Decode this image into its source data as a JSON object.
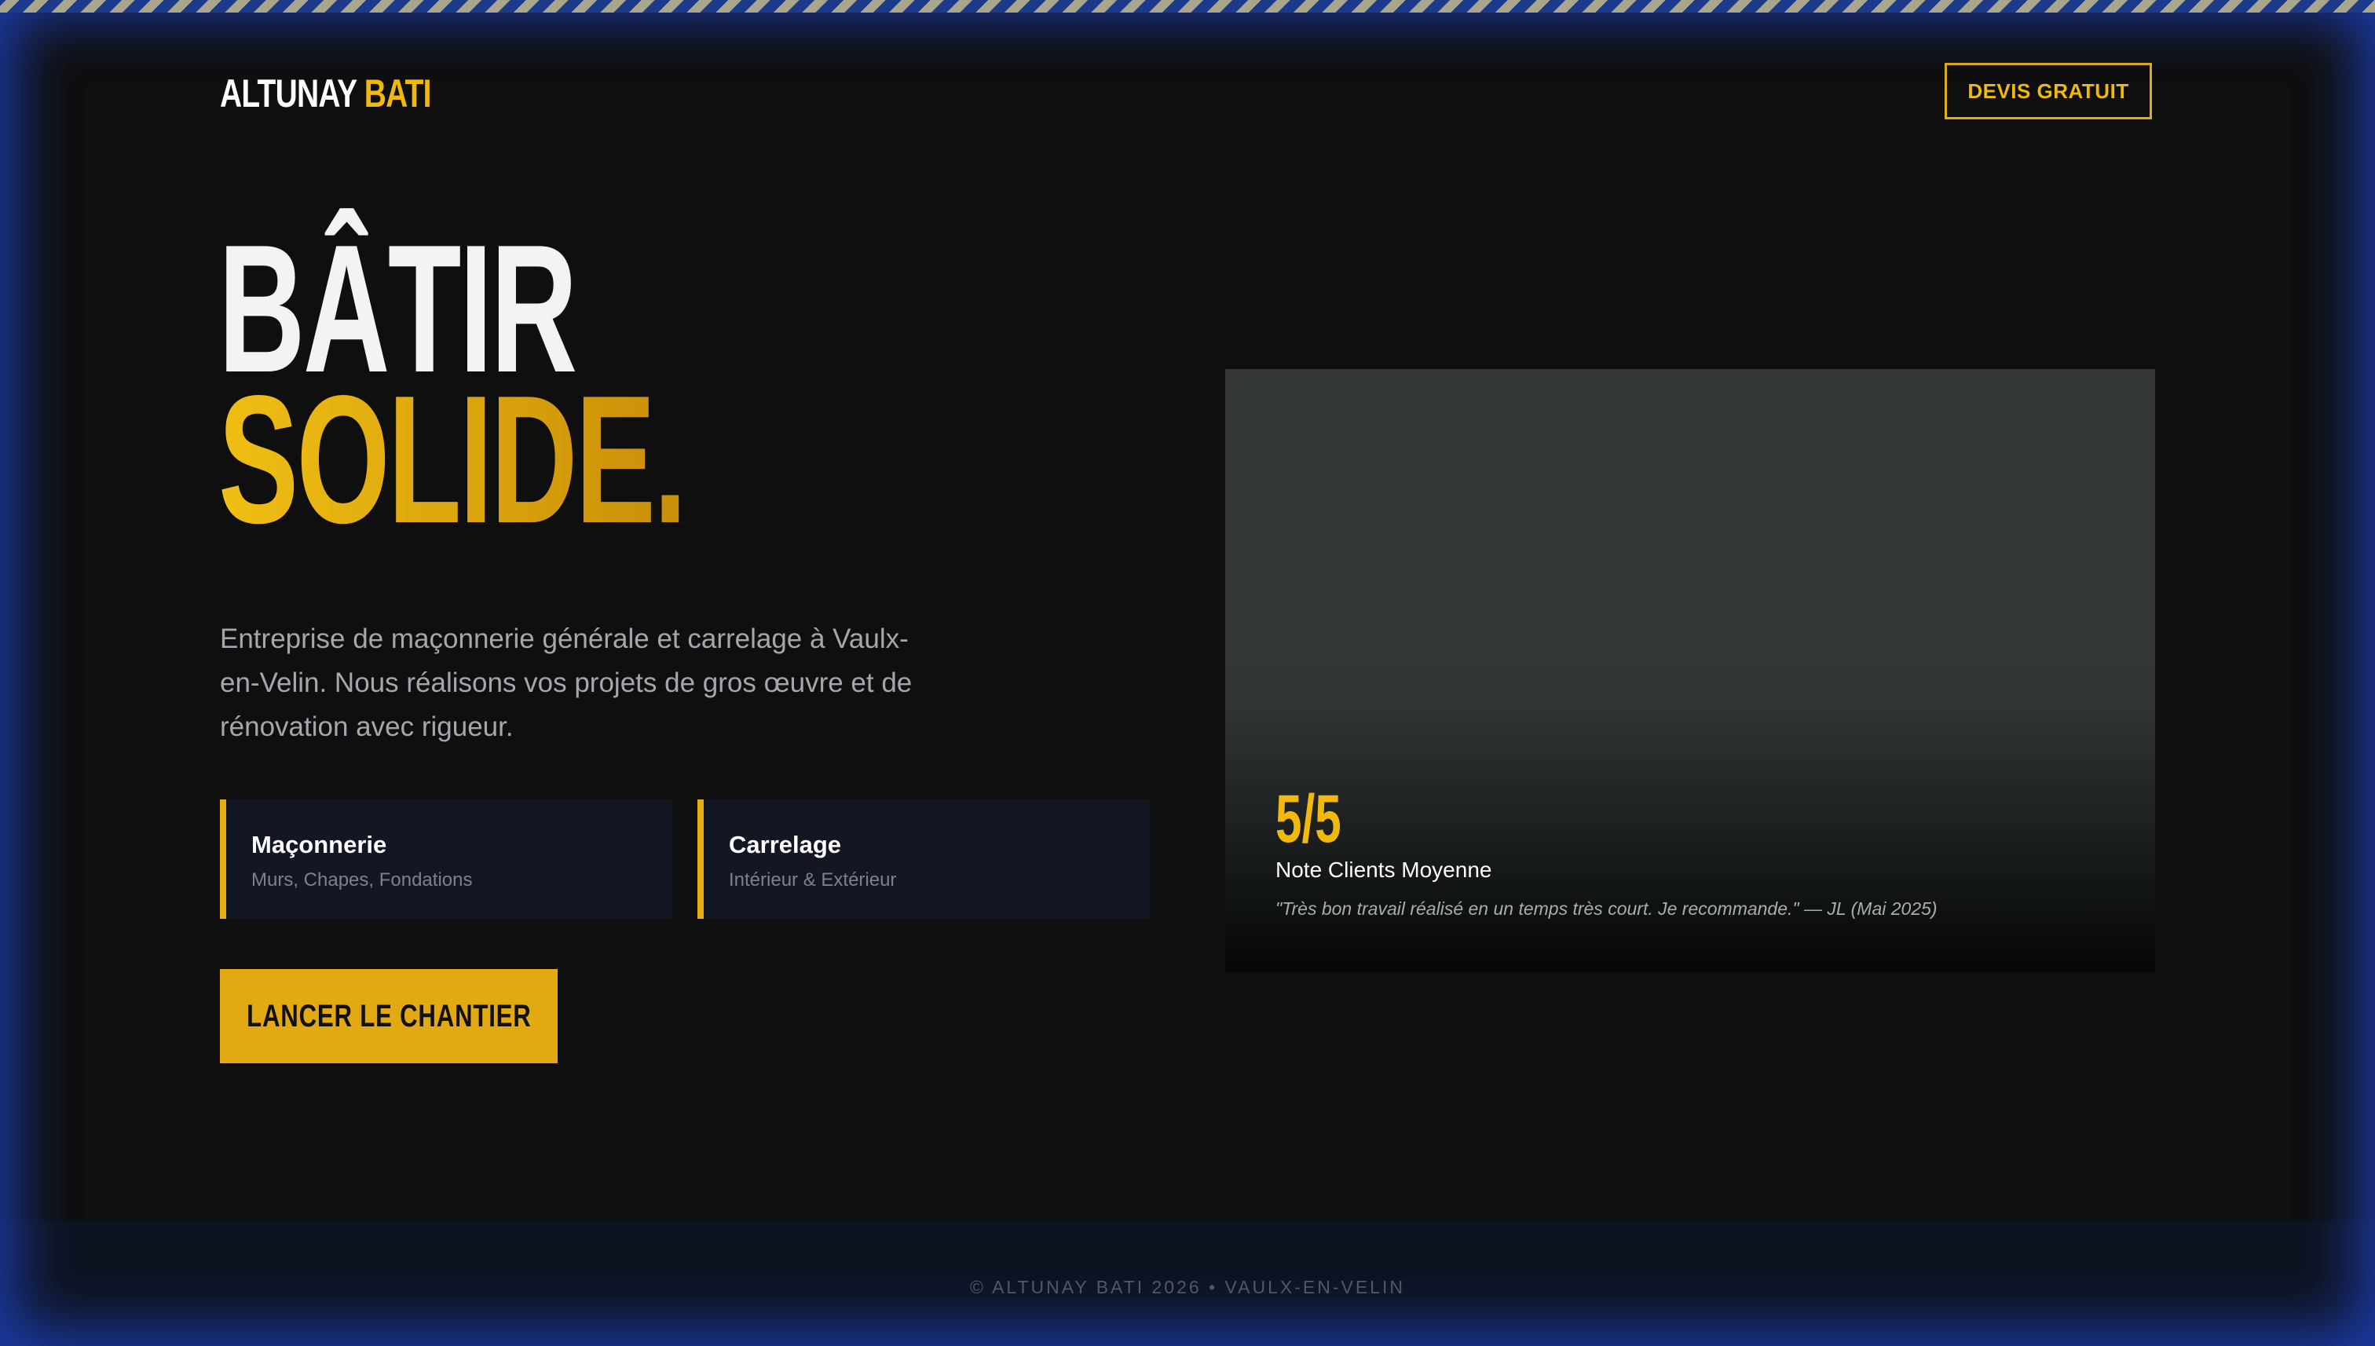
{
  "header": {
    "logo_part1": "ALTUNAY",
    "logo_part2": "BATI",
    "cta_label": "DEVIS GRATUIT"
  },
  "hero": {
    "title_line1": "BÂTIR",
    "title_line2": "SOLIDE.",
    "description": "Entreprise de maçonnerie générale et carrelage à Vaulx-en-Velin. Nous réalisons vos projets de gros œuvre et de rénovation avec rigueur.",
    "services": [
      {
        "title": "Maçonnerie",
        "subtitle": "Murs, Chapes, Fondations"
      },
      {
        "title": "Carrelage",
        "subtitle": "Intérieur & Extérieur"
      }
    ],
    "cta_label": "LANCER LE CHANTIER"
  },
  "review": {
    "score": "5/5",
    "score_label": "Note Clients Moyenne",
    "quote": "\"Très bon travail réalisé en un temps très court. Je recommande.\" — JL (Mai 2025)"
  },
  "footer": {
    "text": "© ALTUNAY BATI 2026 • VAULX-EN-VELIN"
  },
  "colors": {
    "accent": "#f0b90b",
    "background": "#0f0f0f",
    "frame_glow": "#1c3caa",
    "card_bg": "#121723"
  }
}
